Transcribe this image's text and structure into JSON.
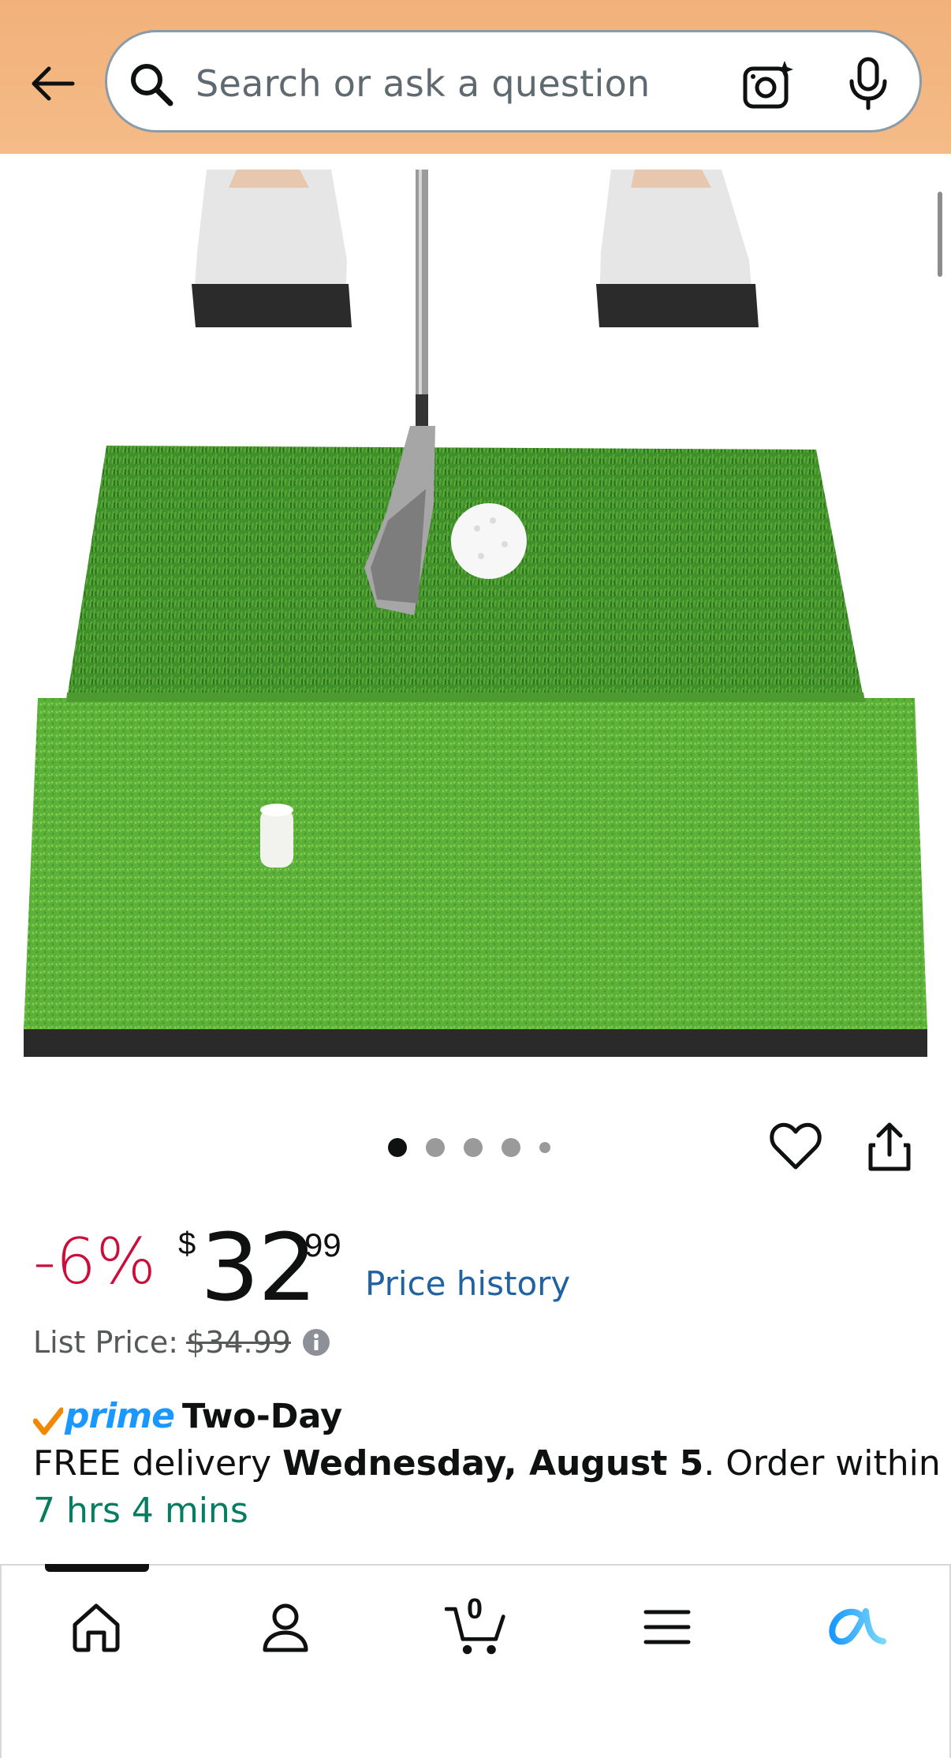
{
  "header": {
    "search_placeholder": "Search or ask a question"
  },
  "product": {
    "image_alt": "Golf hitting mat with iron club, golf ball and rubber tee",
    "carousel_dots": 5,
    "active_dot": 0
  },
  "price": {
    "discount": "-6%",
    "symbol": "$",
    "whole": "32",
    "fraction": "99",
    "history_link": "Price history",
    "list_price_label": "List Price:",
    "list_price_value": "$34.99"
  },
  "delivery": {
    "prime_label": "prime",
    "speed": "Two-Day",
    "prefix": "FREE delivery ",
    "date": "Wednesday, August 5",
    "suffix": ". Order within",
    "countdown": "7 hrs 4 mins"
  },
  "nav": {
    "cart_count": "0",
    "items": [
      "home",
      "account",
      "cart",
      "menu",
      "rufus"
    ]
  },
  "colors": {
    "header_bg": "#f3b580",
    "discount": "#cc0c39",
    "link": "#2162a1",
    "prime": "#1a98ff",
    "countdown": "#067d62"
  }
}
